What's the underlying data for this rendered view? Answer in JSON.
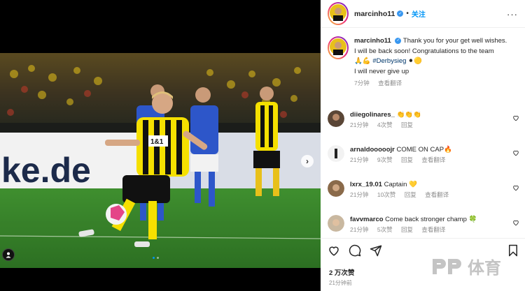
{
  "post": {
    "username": "marcinho11",
    "follow_label": "关注",
    "separator": "•"
  },
  "caption": {
    "username": "marcinho11",
    "line1": "Thank you for your get well wishes.",
    "line2": "I will be back soon! Congratulations to the team",
    "hashtag": "#Derbysieg",
    "line3": "I will never give up",
    "time": "7分钟",
    "translate": "查看翻译"
  },
  "comments": [
    {
      "user": "diiegolinares_",
      "text": "👏👏👏",
      "time": "21分钟",
      "likes": "4次赞",
      "reply": "回复",
      "translate": ""
    },
    {
      "user": "arnaldooooojr",
      "text": "COME ON CAP🔥",
      "time": "21分钟",
      "likes": "9次赞",
      "reply": "回复",
      "translate": "查看翻译"
    },
    {
      "user": "lxrx_19.01",
      "text": "Captain 💛",
      "time": "21分钟",
      "likes": "10次赞",
      "reply": "回复",
      "translate": "查看翻译"
    },
    {
      "user": "favvmarco",
      "text": "Come back stronger champ 🍀",
      "time": "21分钟",
      "likes": "5次赞",
      "reply": "回复",
      "translate": "查看翻译"
    }
  ],
  "actions": {
    "likes": "2 万次赞",
    "time": "21分钟前"
  },
  "media": {
    "banner_text": "ke.de",
    "jersey_number": "1&1"
  },
  "watermark": {
    "text": "体育"
  },
  "colors": {
    "link_blue": "#0095f6",
    "verified_blue": "#3897f0",
    "muted": "#8e8e8e",
    "bvb_yellow": "#f5e000"
  }
}
